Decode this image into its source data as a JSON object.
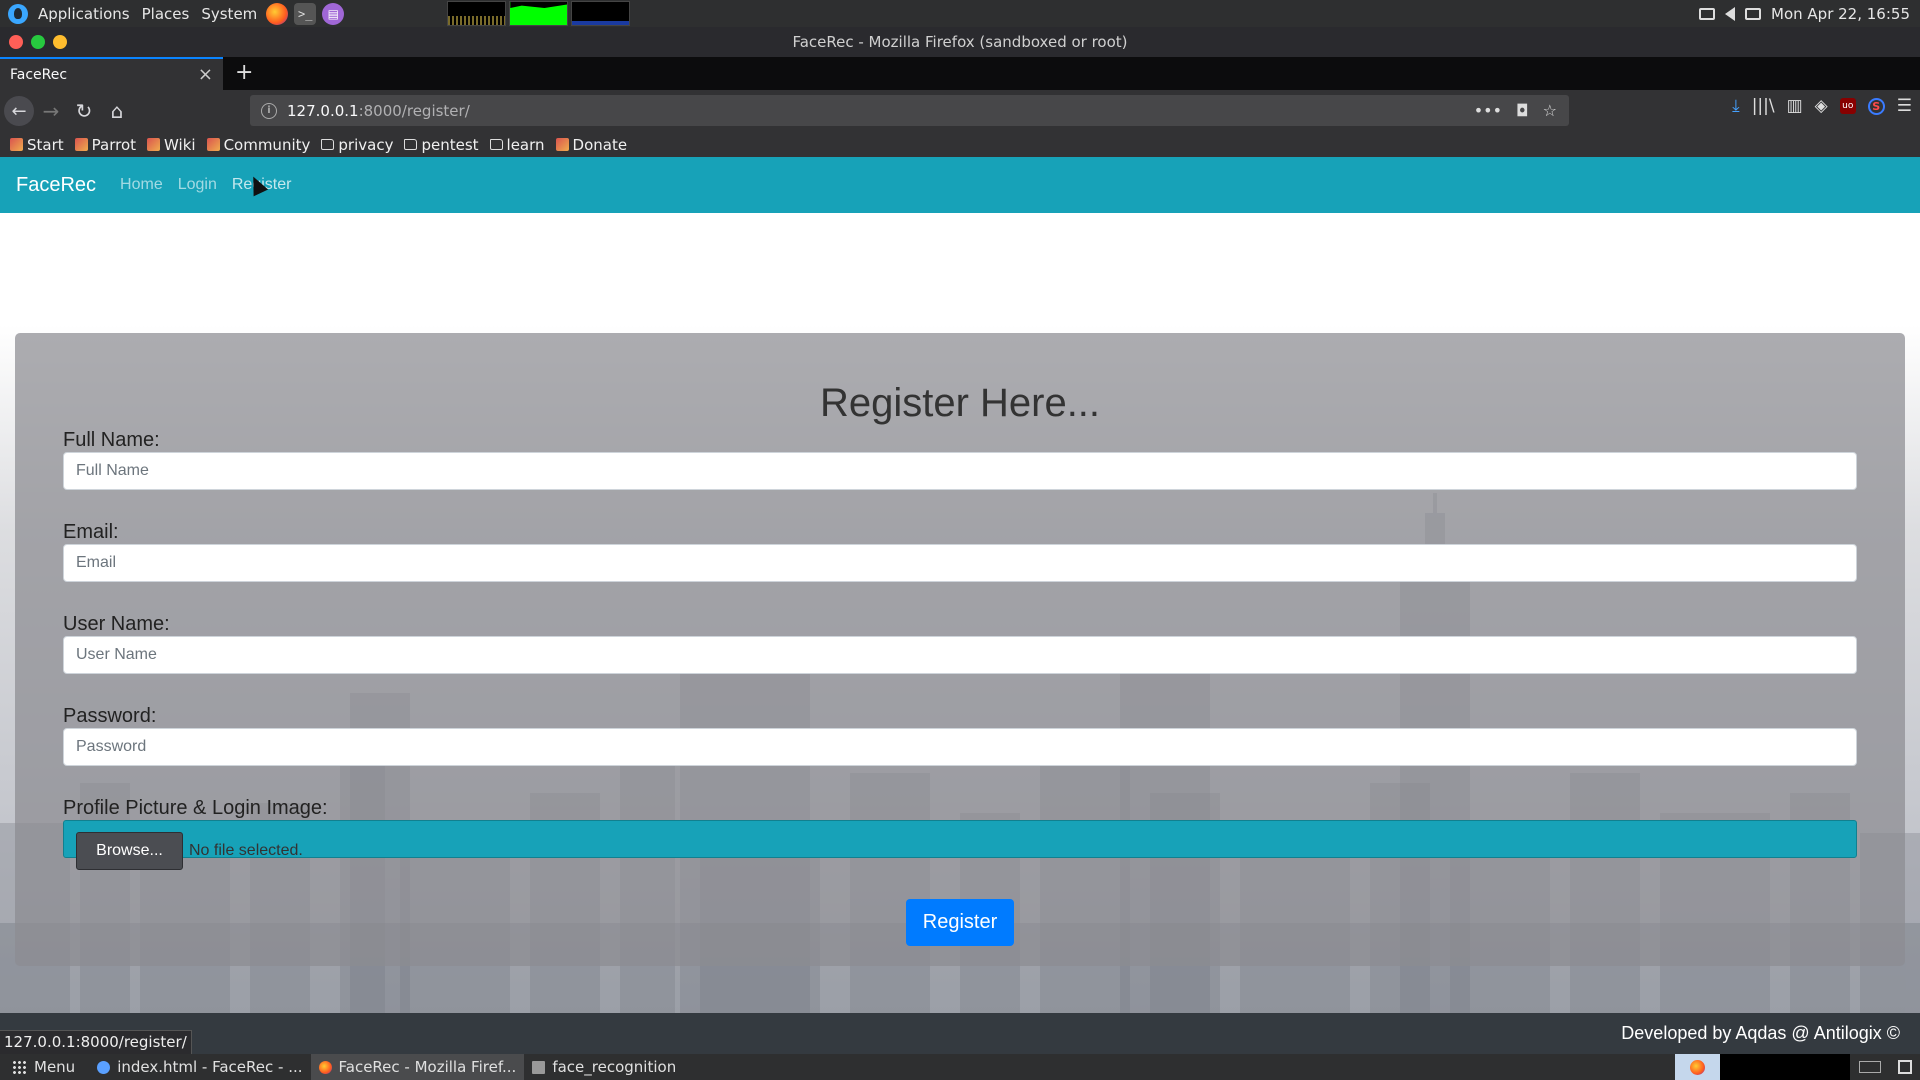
{
  "os_panel": {
    "menus": [
      "Applications",
      "Places",
      "System"
    ],
    "launchers": [
      "firefox-icon",
      "terminal-icon",
      "text-editor-icon"
    ],
    "terminal_glyph": ">_",
    "clock": "Mon Apr 22, 16:55"
  },
  "window": {
    "title": "FaceRec - Mozilla Firefox (sandboxed or root)"
  },
  "tabs": [
    {
      "label": "FaceRec",
      "active": true
    }
  ],
  "urlbar": {
    "host": "127.0.0.1",
    "path": ":8000/register/"
  },
  "bookmarks": [
    {
      "label": "Start",
      "icon": "bookmark-favicon"
    },
    {
      "label": "Parrot",
      "icon": "bookmark-favicon"
    },
    {
      "label": "Wiki",
      "icon": "bookmark-favicon"
    },
    {
      "label": "Community",
      "icon": "bookmark-favicon"
    },
    {
      "label": "privacy",
      "icon": "folder-icon"
    },
    {
      "label": "pentest",
      "icon": "folder-icon"
    },
    {
      "label": "learn",
      "icon": "folder-icon"
    },
    {
      "label": "Donate",
      "icon": "bookmark-favicon"
    }
  ],
  "site": {
    "brand": "FaceRec",
    "nav": [
      "Home",
      "Login",
      "Register"
    ],
    "accent": "#17a2b8"
  },
  "form": {
    "heading": "Register Here...",
    "fields": [
      {
        "label": "Full Name:",
        "placeholder": "Full Name",
        "value": ""
      },
      {
        "label": "Email:",
        "placeholder": "Email",
        "value": ""
      },
      {
        "label": "User Name:",
        "placeholder": "User Name",
        "value": ""
      },
      {
        "label": "Password:",
        "placeholder": "Password",
        "value": ""
      }
    ],
    "file_label": "Profile Picture & Login Image:",
    "browse_label": "Browse...",
    "file_status": "No file selected.",
    "submit_label": "Register",
    "submit_color": "#007bff"
  },
  "footer": {
    "credit": "Developed by Aqdas @ Antilogix ©"
  },
  "status_url": "127.0.0.1:8000/register/",
  "taskbar": {
    "menu_label": "Menu",
    "tasks": [
      {
        "label": "index.html - FaceRec - ...",
        "active": false
      },
      {
        "label": "FaceRec - Mozilla Firef...",
        "active": true
      },
      {
        "label": "face_recognition",
        "active": false
      }
    ]
  }
}
